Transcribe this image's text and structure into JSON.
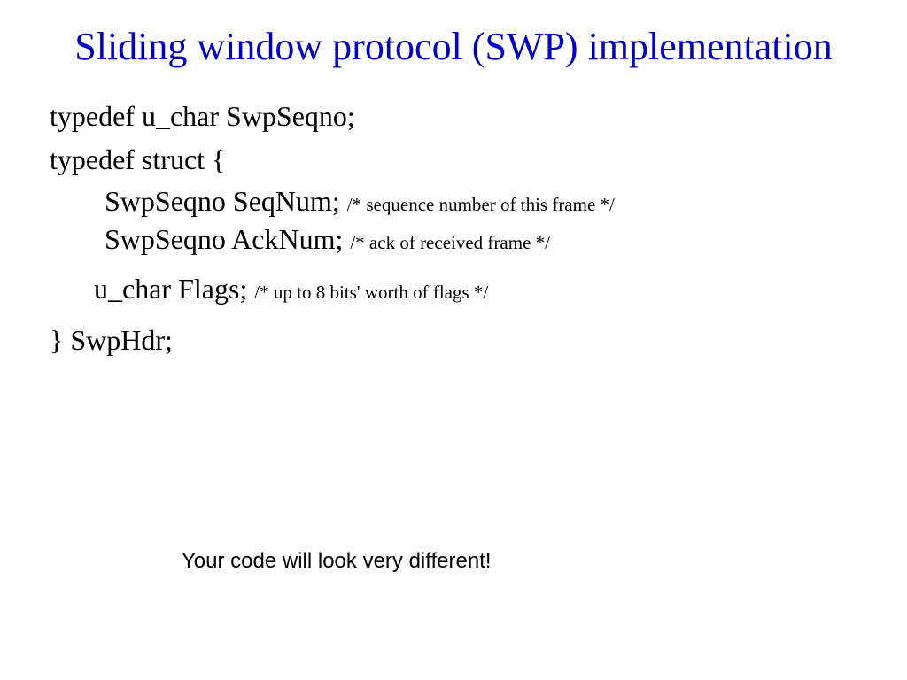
{
  "title": "Sliding window protocol (SWP) implementation",
  "code": {
    "line1": "typedef u_char SwpSeqno;",
    "line2": "typedef struct {",
    "seqnum_decl": "SwpSeqno SeqNum;",
    "seqnum_comment": "/* sequence number of this frame */",
    "acknum_decl": "SwpSeqno AckNum;",
    "acknum_comment": "/* ack of received frame */",
    "flags_decl": "u_char Flags;",
    "flags_comment": "/* up to 8 bits' worth of flags */",
    "close": "} SwpHdr;"
  },
  "note": "Your code will look very different!"
}
